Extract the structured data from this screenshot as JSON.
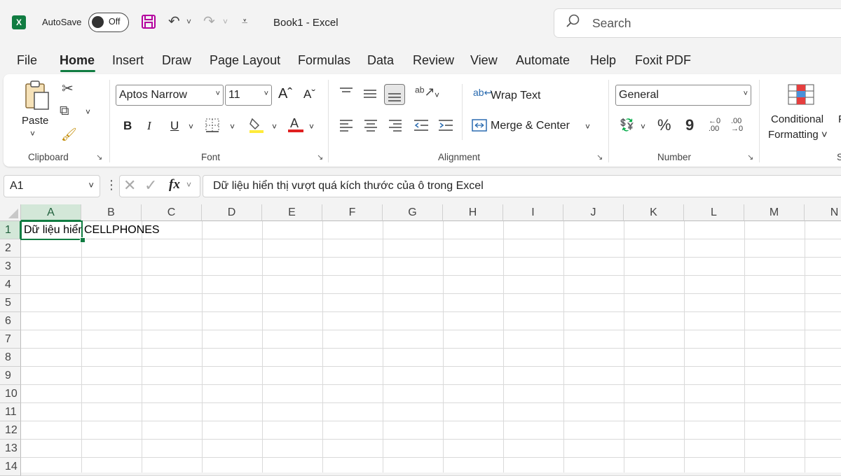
{
  "titlebar": {
    "app_icon": "excel-icon",
    "autosave_label": "AutoSave",
    "autosave_state": "Off",
    "doc_title": "Book1  -  Excel",
    "search_placeholder": "Search"
  },
  "menu": [
    "File",
    "Home",
    "Insert",
    "Draw",
    "Page Layout",
    "Formulas",
    "Data",
    "Review",
    "View",
    "Automate",
    "Help",
    "Foxit PDF"
  ],
  "active_menu": "Home",
  "ribbon": {
    "clipboard": {
      "paste_label": "Paste",
      "group_label": "Clipboard"
    },
    "font": {
      "font_name": "Aptos Narrow",
      "font_size": "11",
      "bold": "B",
      "italic": "I",
      "underline": "U",
      "group_label": "Font"
    },
    "alignment": {
      "wrap_text": "Wrap Text",
      "merge_center": "Merge & Center",
      "group_label": "Alignment"
    },
    "number": {
      "format": "General",
      "percent": "%",
      "comma": "9",
      "group_label": "Number"
    },
    "styles": {
      "conditional_line1": "Conditional",
      "conditional_line2": "Formatting ˅",
      "cut_text": "F",
      "group_cut": "S"
    }
  },
  "formula_bar": {
    "name_box": "A1",
    "fx": "fx",
    "formula": "Dữ liệu hiển thị vượt quá kích thước của ô trong Excel"
  },
  "grid": {
    "columns": [
      "A",
      "B",
      "C",
      "D",
      "E",
      "F",
      "G",
      "H",
      "I",
      "J",
      "K",
      "L",
      "M",
      "N"
    ],
    "rows": [
      "1",
      "2",
      "3",
      "4",
      "5",
      "6",
      "7",
      "8",
      "9",
      "10",
      "11",
      "12",
      "13",
      "14"
    ],
    "selected_column": "A",
    "selected_row": "1",
    "cells": {
      "A1": "Dữ liệu hiển thị vượt quá kích thước của ô trong Excel",
      "B1": "CELLPHONES"
    }
  }
}
